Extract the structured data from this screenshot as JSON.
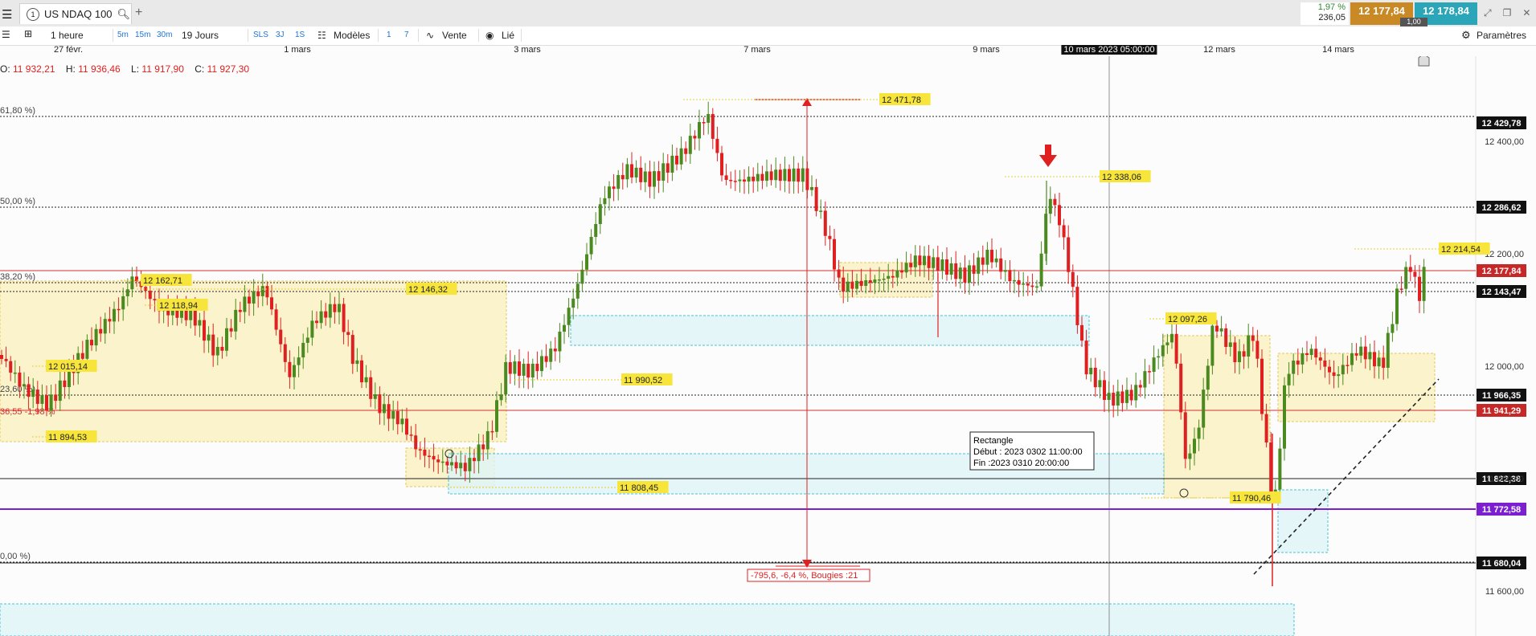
{
  "window": {
    "tab_number": "1",
    "tab_title": "US NDAQ 100",
    "change_pct": "1,97 %",
    "change_pts": "236,05",
    "bid": "12 177,84",
    "ask": "12 178,84",
    "spread": "1,00"
  },
  "toolbar": {
    "timeframe": "1 heure",
    "tf_buttons": [
      "5m",
      "15m",
      "30m"
    ],
    "period": "19 Jours",
    "mode_buttons": [
      "SLS",
      "3J",
      "1S"
    ],
    "models": "Modèles",
    "num_buttons": [
      "1",
      "7"
    ],
    "sell": "Vente",
    "linked": "Lié",
    "settings": "Paramètres"
  },
  "date_axis": {
    "labels": [
      "27 févr.",
      "1 mars",
      "3 mars",
      "7 mars",
      "9 mars",
      "10 mars 2023 05:00:00",
      "12 mars",
      "14 mars"
    ]
  },
  "ohlc": {
    "o_label": "O:",
    "o": "11 932,21",
    "h_label": "H:",
    "h": "11 936,46",
    "l_label": "L:",
    "l": "11 917,90",
    "c_label": "C:",
    "c": "11 927,30"
  },
  "colors": {
    "up": "#4a8a1f",
    "down": "#e02020",
    "zone_yellow": "#fbf0b8",
    "zone_blue": "#dff4f8",
    "last_price": "#c62828",
    "purple": "#7b1fd1"
  },
  "chart_data": {
    "type": "candlestick",
    "symbol": "US NDAQ 100",
    "timeframe": "1 heure",
    "y_ticks": [
      "12 400,00",
      "12 200,00",
      "12 000,00",
      "11 800,00",
      "11 600,00"
    ],
    "price_tags": [
      {
        "label": "12 429,78",
        "style": "dark"
      },
      {
        "label": "12 286,62",
        "style": "dark"
      },
      {
        "label": "12 177,84",
        "style": "red"
      },
      {
        "label": "12 143,47",
        "style": "dark"
      },
      {
        "label": "11 966,35",
        "style": "dark"
      },
      {
        "label": "11 941,29",
        "style": "red"
      },
      {
        "label": "11 822,38",
        "style": "dark"
      },
      {
        "label": "11 772,58",
        "style": "purple"
      },
      {
        "label": "11 680,04",
        "style": "dark"
      }
    ],
    "fib_labels": [
      "61,80 %)",
      "50,00 %)",
      "38,20 %)",
      "23,60 %)",
      "0,00 %)"
    ],
    "pct_label": "-1,98 %",
    "pct_prefix": "36,55",
    "annotations": [
      "12 471,78",
      "12 338,06",
      "12 214,54",
      "12 162,71",
      "12 146,32",
      "12 118,94",
      "12 097,26",
      "12 015,14",
      "11 990,52",
      "11 894,53",
      "11 808,45",
      "11 790,46"
    ],
    "measure": "-795,6, -6,4 %, Bougies :21",
    "tooltip": {
      "title": "Rectangle",
      "start": "Début : 2023 0302 11:00:00",
      "end": "Fin :2023 0310 20:00:00"
    },
    "ylim": [
      11540,
      12560
    ]
  }
}
